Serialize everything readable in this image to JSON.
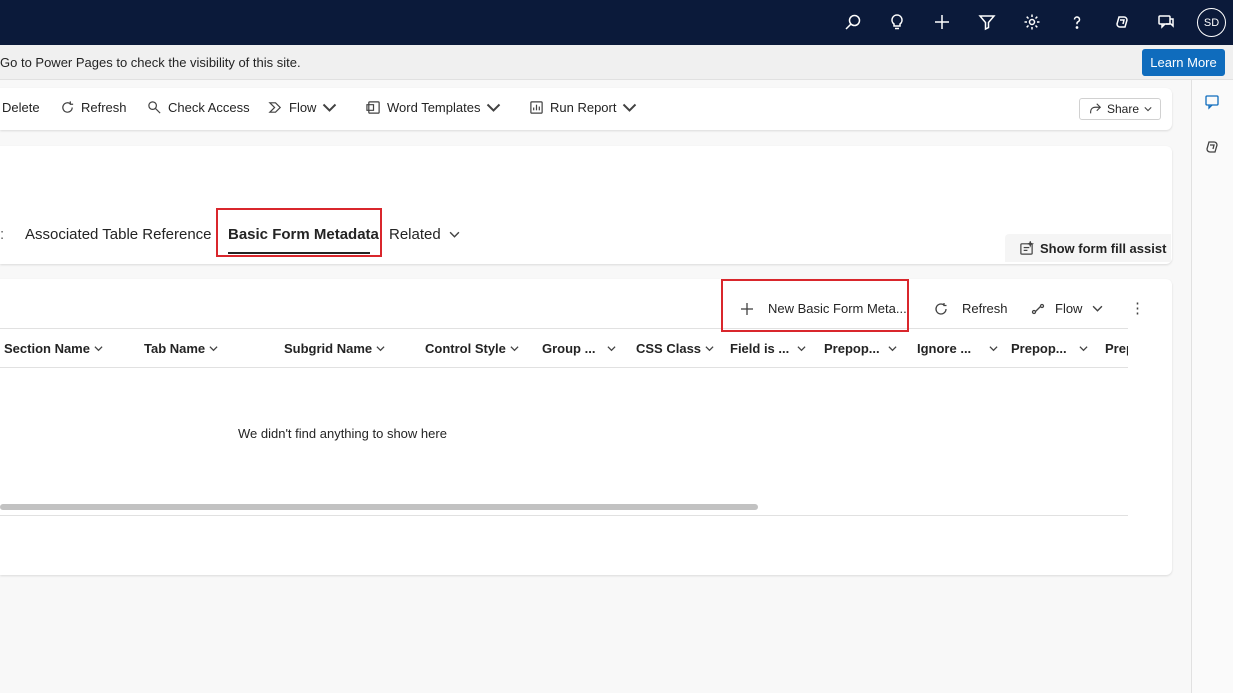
{
  "topbar": {
    "icons": [
      "search-icon",
      "lightbulb-icon",
      "plus-icon",
      "filter-icon",
      "gear-icon",
      "help-icon",
      "copilot-icon",
      "chat-icon"
    ],
    "avatar_initials": "SD"
  },
  "notice": {
    "text": "Go to Power Pages to check the visibility of this site.",
    "learn_more": "Learn More"
  },
  "commandbar": {
    "delete": "Delete",
    "refresh": "Refresh",
    "check_access": "Check Access",
    "flow": "Flow",
    "word_templates": "Word Templates",
    "run_report": "Run Report",
    "share": "Share"
  },
  "tabs": {
    "associated_table_reference": "Associated Table Reference",
    "basic_form_metadata": "Basic Form Metadata",
    "related": "Related",
    "selected": "Basic Form Metadata"
  },
  "fill_assist": "Show form fill assist",
  "subgrid": {
    "new_button": "New Basic Form Meta...",
    "refresh": "Refresh",
    "flow": "Flow",
    "columns": [
      "Section Name",
      "Tab Name",
      "Subgrid Name",
      "Control Style",
      "Group ...",
      "CSS Class",
      "Field is ...",
      "Prepop...",
      "Ignore ...",
      "Prepop...",
      "Prep"
    ],
    "empty_message": "We didn't find anything to show here"
  },
  "colors": {
    "topbar_bg": "#0b1a3a",
    "accent": "#0f6cbd",
    "highlight": "#d9262c"
  }
}
